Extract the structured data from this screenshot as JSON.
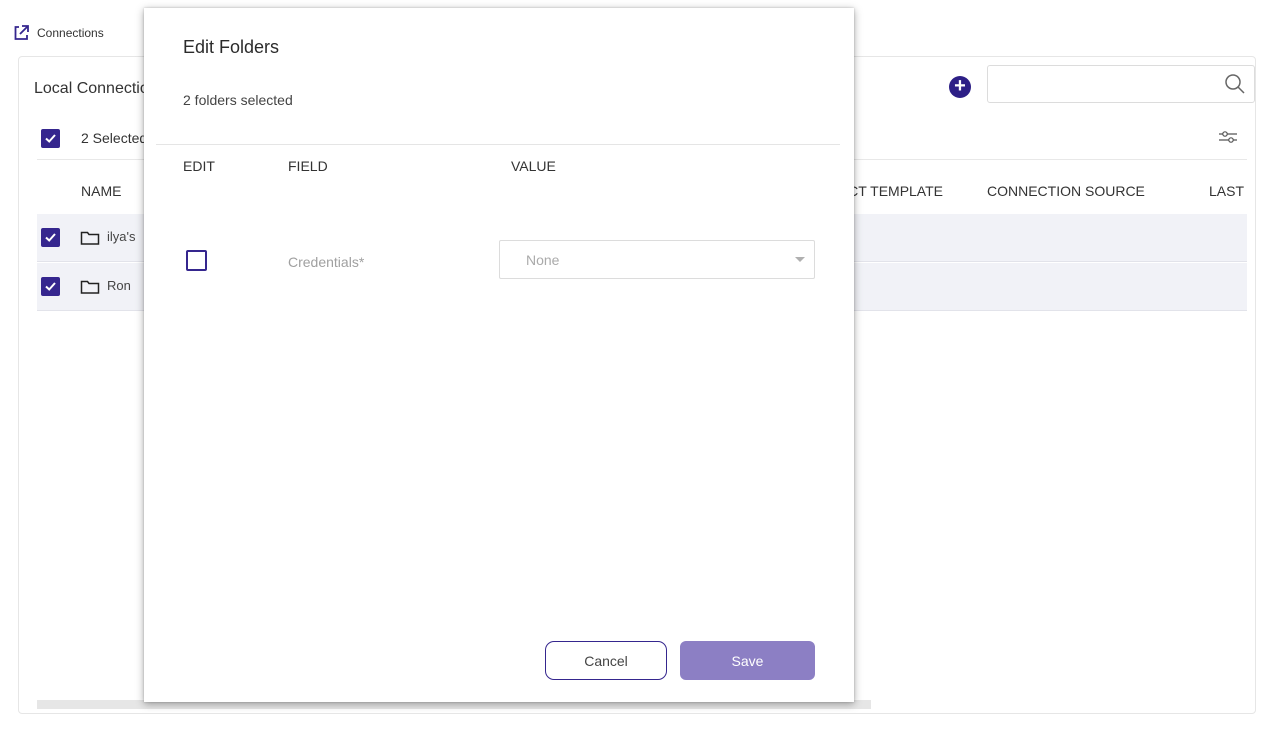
{
  "tab": {
    "label": "Connections",
    "icon": "external-link-icon"
  },
  "panel": {
    "title": "Local Connections",
    "add_icon": "plus-circle-icon",
    "search": {
      "placeholder": "",
      "icon": "search-icon"
    },
    "selection": {
      "text": "2 Selected",
      "filter_icon": "filter-sliders-icon"
    },
    "columns": [
      "NAME",
      "CONNECT TEMPLATE",
      "CONNECTION SOURCE",
      "LAST"
    ],
    "rows": [
      {
        "name": "ilya's",
        "checked": true,
        "icon": "folder-icon"
      },
      {
        "name": "Ron",
        "checked": true,
        "icon": "folder-icon"
      }
    ]
  },
  "modal": {
    "title": "Edit Folders",
    "subtitle": "2 folders selected",
    "headers": {
      "edit": "EDIT",
      "field": "FIELD",
      "value": "VALUE"
    },
    "fields": [
      {
        "label": "Credentials*",
        "value": "None",
        "checked": false
      }
    ],
    "cancel_label": "Cancel",
    "save_label": "Save"
  },
  "colors": {
    "accent": "#35268e",
    "save_disabled": "#8c7fc4",
    "row_bg": "#f1f2f7"
  }
}
